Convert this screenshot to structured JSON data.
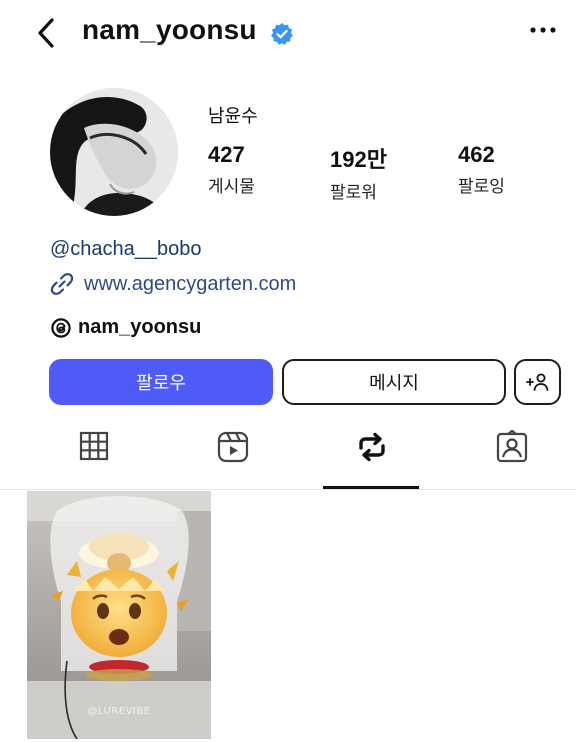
{
  "header": {
    "username": "nam_yoonsu",
    "verified": true,
    "icons": {
      "back": "chevron-left-icon",
      "verified": "verified-badge-icon",
      "more": "more-horizontal-icon"
    }
  },
  "profile": {
    "display_name": "남윤수",
    "stats": [
      {
        "value": "427",
        "label": "게시물"
      },
      {
        "value": "192만",
        "label": "팔로워"
      },
      {
        "value": "462",
        "label": "팔로잉"
      }
    ],
    "bio_handle": "@chacha__bobo",
    "link": "www.agencygarten.com",
    "threads_handle": "nam_yoonsu"
  },
  "actions": {
    "follow_label": "팔로우",
    "message_label": "메시지",
    "add_icon": "add-person-icon"
  },
  "tabs": [
    {
      "name": "grid",
      "icon": "grid-icon",
      "selected": false
    },
    {
      "name": "reels",
      "icon": "reels-icon",
      "selected": false
    },
    {
      "name": "reposts",
      "icon": "repost-icon",
      "selected": true
    },
    {
      "name": "tagged",
      "icon": "tagged-icon",
      "selected": false
    }
  ],
  "posts": [
    {
      "caption": "@LUREVIBE"
    }
  ],
  "colors": {
    "accent": "#4e5bf6",
    "verified": "#3897f0",
    "link": "#2e4a8e"
  }
}
